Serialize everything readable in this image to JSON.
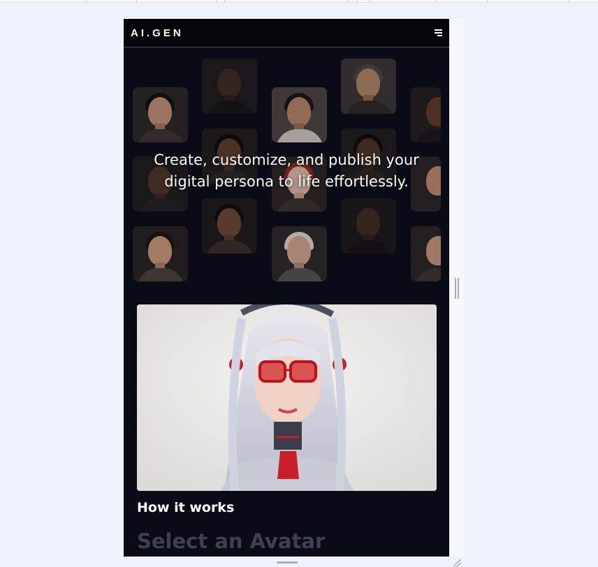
{
  "brand": {
    "name": "AI.GEN"
  },
  "nav": {
    "menu_icon": "hamburger-menu-icon"
  },
  "hero": {
    "tagline_line1": "Create, customize, and publish your",
    "tagline_line2": "digital persona to life effortlessly."
  },
  "feature": {
    "image_alt": "AI avatar with silver hair and red glasses",
    "title": "How it works",
    "subtitle": "Select an Avatar"
  },
  "colors": {
    "page_bg": "#eef2fb",
    "device_bg": "#0b0b18",
    "navbar_bg": "#05050b",
    "accent": "#d0202a"
  }
}
